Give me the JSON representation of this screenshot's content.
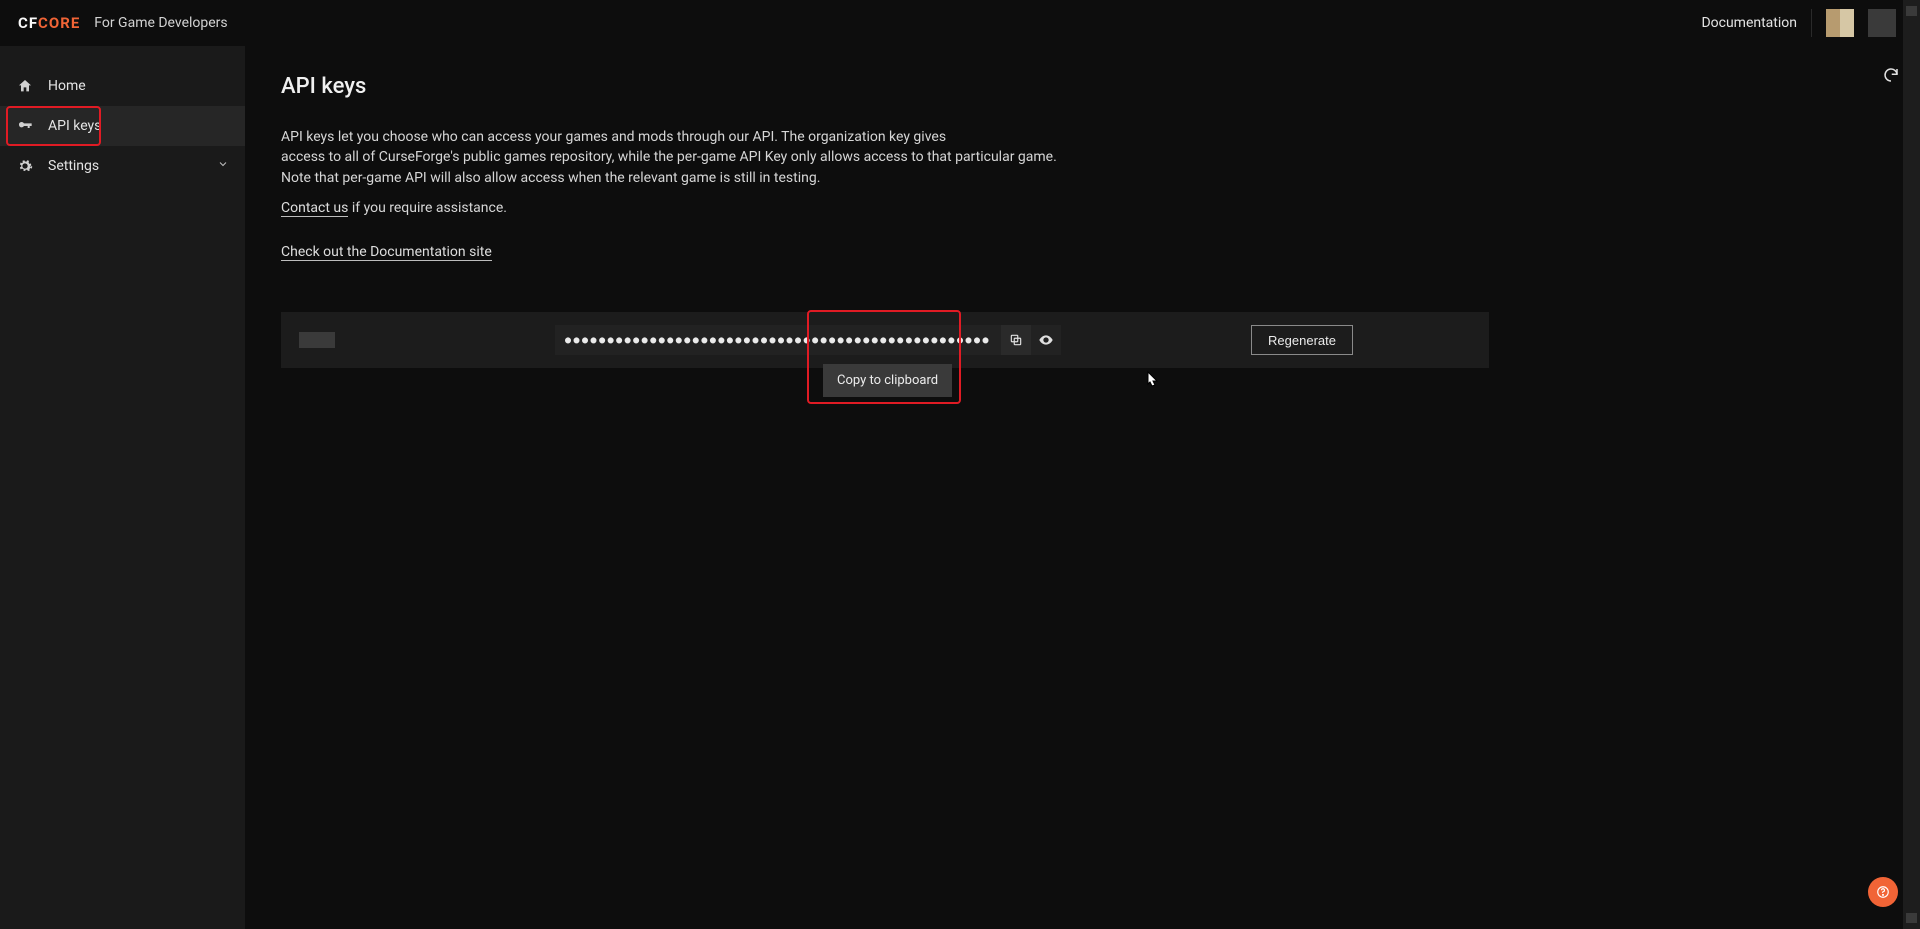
{
  "brand": {
    "cf": "CF",
    "core": "CORE",
    "sub": "For Game Developers"
  },
  "topbar": {
    "documentation": "Documentation"
  },
  "sidebar": {
    "items": [
      {
        "label": "Home"
      },
      {
        "label": "API keys"
      },
      {
        "label": "Settings"
      }
    ]
  },
  "page": {
    "title": "API keys",
    "desc_line1": "API keys let you choose who can access your games and mods through our API. The organization key gives",
    "desc_line2": "access to all of CurseForge's public games repository, while the per-game API Key only allows access to that particular game.",
    "desc_line3": "Note that per-game API will also allow access when the relevant game is still in testing.",
    "contact_us": "Contact us",
    "contact_rest": " if you require assistance.",
    "doc_link": "Check out the Documentation site"
  },
  "keyrow": {
    "masked_value": "●●●●●●●●●●●●●●●●●●●●●●●●●●●●●●●●●●●●●●●●●●●●●●●●●●",
    "regenerate": "Regenerate",
    "tooltip": "Copy to clipboard"
  },
  "icons": {
    "home": "home-icon",
    "key": "key-icon",
    "gear": "gear-icon",
    "chevron": "chevron-down-icon",
    "refresh": "refresh-icon",
    "copy": "copy-icon",
    "eye": "eye-icon",
    "help": "help-icon"
  }
}
